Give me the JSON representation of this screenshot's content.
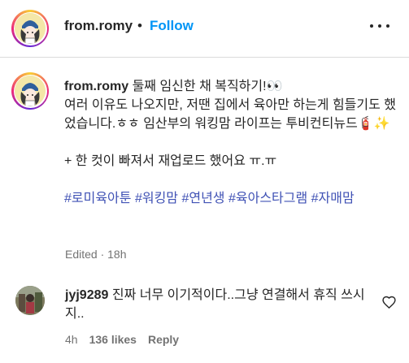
{
  "header": {
    "username": "from.romy",
    "separator": "•",
    "follow_label": "Follow",
    "more_icon": "more-horizontal-icon"
  },
  "caption": {
    "username": "from.romy",
    "line1": "둘째 임신한 채 복직하기!👀",
    "line2": "여러 이유도 나오지만, 저땐 집에서 육아만 하는게 힘들기도 했었습니다.ㅎㅎ 임산부의 워킹맘 라이프는 투비컨티뉴드🧯✨",
    "line3": "+ 한 컷이 빠져서 재업로드 했어요 ㅠ.ㅠ",
    "hashtags": [
      "#로미육아툰",
      "#워킹맘",
      "#연년생",
      "#육아스타그램",
      "#자매맘"
    ],
    "meta": "Edited · 18h"
  },
  "comment": {
    "username": "jyj9289",
    "text": "진짜 너무 이기적이다..그냥 연결해서 휴직 쓰시지..",
    "time": "4h",
    "likes": "136 likes",
    "reply_label": "Reply",
    "like_icon": "heart-outline-icon"
  }
}
